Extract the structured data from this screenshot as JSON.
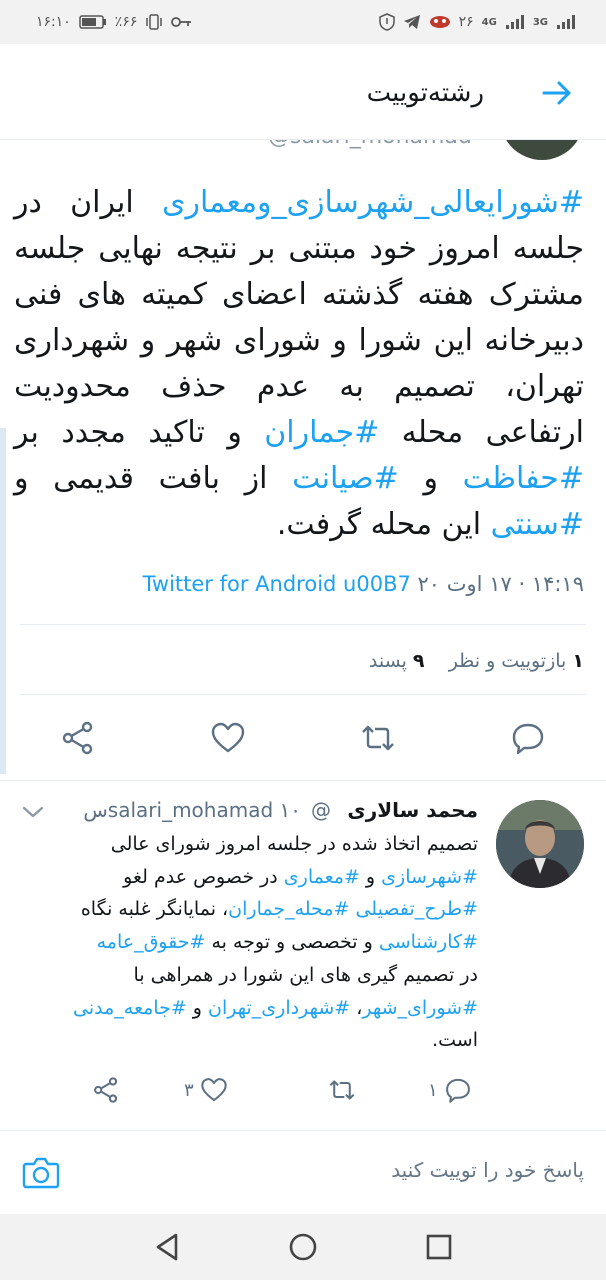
{
  "status_bar": {
    "time": "۱۶:۱۰",
    "battery": "٪۶۶",
    "notification_count": "۲۶",
    "network_left": "4G",
    "network_right": "3G",
    "icons": [
      "key-icon",
      "vibrate-icon",
      "battery-icon",
      "signal-icon",
      "telegram-icon",
      "shield-icon"
    ]
  },
  "header": {
    "title": "رشته‌توییت",
    "back_icon": "arrow-right-icon",
    "peek_handle": "@salari_mohamad"
  },
  "main_tweet": {
    "segments": [
      {
        "t": "#شورایعالی_شهرسازی_ومعماری",
        "tag": true
      },
      {
        "t": " ایران در جلسه امروز خود مبتنی بر نتیجه نهایی جلسه مشترک هفته گذشته اعضای کمیته های فنی دبیرخانه این شورا و شورای شهر و شهرداری تهران، تصمیم به عدم حذف محدودیت ارتفاعی محله ",
        "tag": false
      },
      {
        "t": "#جماران",
        "tag": true
      },
      {
        "t": " و تاکید مجدد بر ",
        "tag": false
      },
      {
        "t": "#حفاظت",
        "tag": true
      },
      {
        "t": " و ",
        "tag": false
      },
      {
        "t": "#صیانت",
        "tag": true
      },
      {
        "t": " از بافت قدیمی و ",
        "tag": false
      },
      {
        "t": "#سنتی",
        "tag": true
      },
      {
        "t": " این محله گرفت.",
        "tag": false
      }
    ],
    "timestamp": "۱۴:۱۹ · ۱۷ اوت ۲۰",
    "source": "Twitter for Android u00B7",
    "retweets_count": "۱",
    "retweets_label": "بازتوییت و نظر",
    "likes_count": "۹",
    "likes_label": "پسند"
  },
  "reply": {
    "name": "محمد سالاری",
    "handle": "@salari_mohamad",
    "time": "۱۰س",
    "lines": [
      [
        {
          "t": "تصمیم اتخاذ شده در جلسه امروز شورای عالی",
          "tag": false
        }
      ],
      [
        {
          "t": "#شهرسازی",
          "tag": true
        },
        {
          "t": " و ",
          "tag": false
        },
        {
          "t": "#معماری",
          "tag": true
        },
        {
          "t": " در خصوص عدم لغو",
          "tag": false
        }
      ],
      [
        {
          "t": "#طرح_تفصیلی",
          "tag": true
        },
        {
          "t": " ",
          "tag": false
        },
        {
          "t": "#محله_جماران",
          "tag": true
        },
        {
          "t": "، نمایانگر غلبه نگاه",
          "tag": false
        }
      ],
      [
        {
          "t": "#کارشناسی",
          "tag": true
        },
        {
          "t": " و تخصصی و توجه به ",
          "tag": false
        },
        {
          "t": "#حقوق_عامه",
          "tag": true
        }
      ],
      [
        {
          "t": "در تصمیم گیری های این شورا در همراهی با",
          "tag": false
        }
      ],
      [
        {
          "t": "#شورای_شهر",
          "tag": true
        },
        {
          "t": "، ",
          "tag": false
        },
        {
          "t": "#شهرداری_تهران",
          "tag": true
        },
        {
          "t": " و ",
          "tag": false
        },
        {
          "t": "#جامعه_مدنی",
          "tag": true
        }
      ],
      [
        {
          "t": "است.",
          "tag": false
        }
      ]
    ],
    "replies_count": "۱",
    "likes_count": "۳"
  },
  "composer": {
    "placeholder": "پاسخ خود را توییت کنید"
  },
  "colors": {
    "accent": "#1da1f2",
    "text": "#14171a",
    "muted": "#5b7083"
  }
}
